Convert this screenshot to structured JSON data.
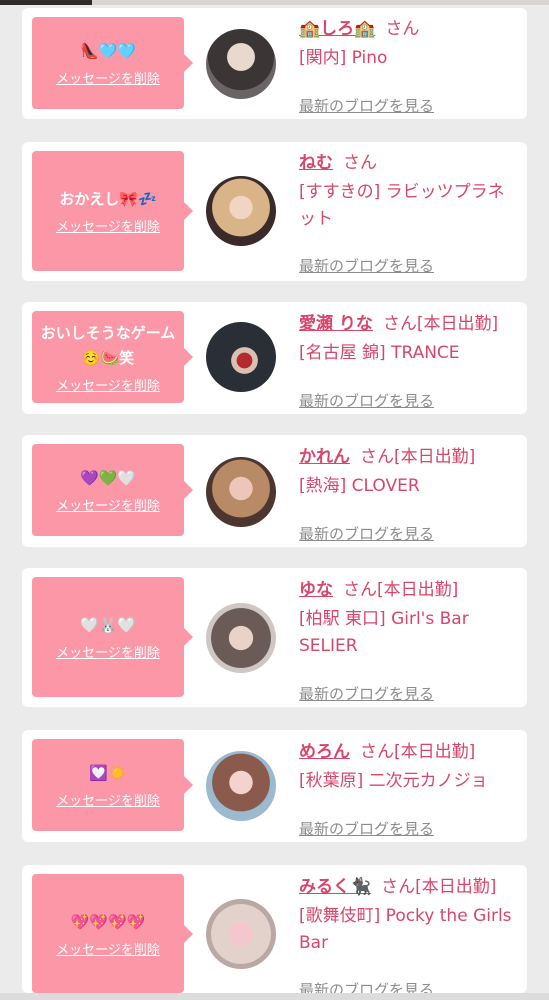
{
  "colors": {
    "accent": "#fc97a8",
    "name": "#d9466b",
    "link": "#8c8c8c"
  },
  "delete_label": "メッセージを削除",
  "blog_label": "最新のブログを見る",
  "cards": [
    {
      "message": "👠🩵🩵",
      "name": "🏫しろ🏫",
      "suffix": "さん",
      "shop": "[関内] Pino"
    },
    {
      "message": "おかえし🎀💤",
      "name": "ねむ",
      "suffix": "さん",
      "shop": "[すすきの] ラビッツプラネット"
    },
    {
      "message": "おいしそうなゲーム☺️🍉笑",
      "name": "愛瀬 りな",
      "suffix": "さん[本日出勤]",
      "shop": "[名古屋 錦] TRANCE"
    },
    {
      "message": "💜💚🤍",
      "name": "かれん",
      "suffix": "さん[本日出勤]",
      "shop": "[熱海] CLOVER"
    },
    {
      "message": "🤍🐰🤍",
      "name": "ゆな",
      "suffix": "さん[本日出勤]",
      "shop": "[柏駅 東口] Girl's Bar SELIER"
    },
    {
      "message": "💟☀️",
      "name": "めろん",
      "suffix": "さん[本日出勤]",
      "shop": "[秋葉原] 二次元カノジョ"
    },
    {
      "message": "💖💖💖💖",
      "name": "みるく🐈‍⬛",
      "suffix": "さん[本日出勤]",
      "shop": "[歌舞伎町] Pocky the Girls Bar"
    }
  ]
}
